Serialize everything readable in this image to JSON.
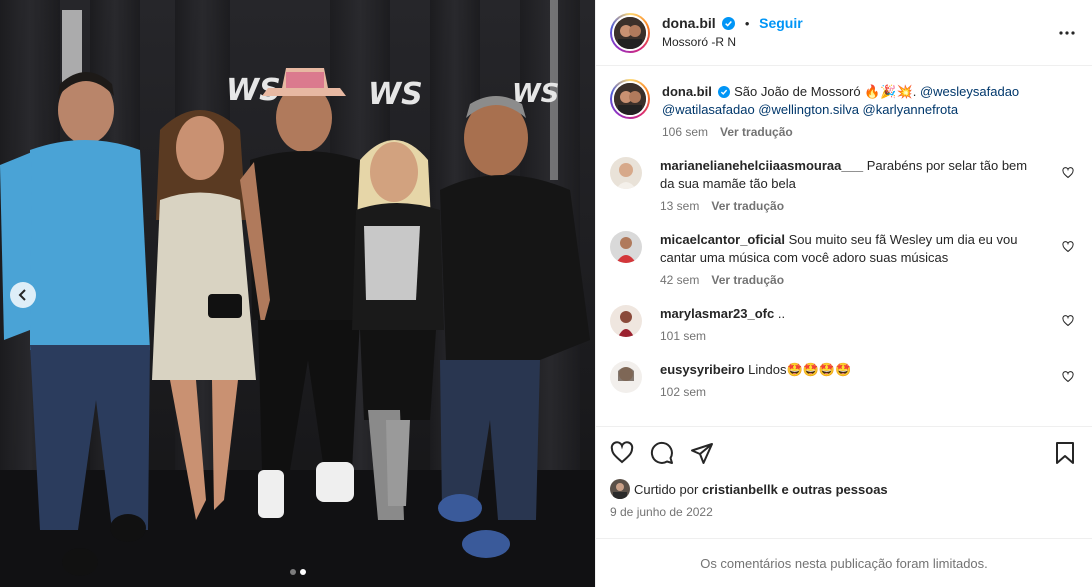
{
  "post": {
    "username": "dona.bil",
    "follow_label": "Seguir",
    "location": "Mossoró -R N",
    "separator": "•",
    "more_icon": "more-horizontal-icon"
  },
  "carousel": {
    "slides": 2,
    "current": 2
  },
  "caption": {
    "username": "dona.bil",
    "text": "São João de Mossoró 🔥🎉💥.",
    "mentions_line1": "@wesleysafadao",
    "mentions_line2": "@watilasafadao @wellington.silva @karlyannefrota",
    "time": "106 sem",
    "translate": "Ver tradução"
  },
  "comments": [
    {
      "username": "marianelianehelciiaasmouraa___",
      "text": "Parabéns por selar tão bem da sua mamãe tão bela",
      "time": "13 sem",
      "translate": "Ver tradução"
    },
    {
      "username": "micaelcantor_oficial",
      "text": "Sou muito seu fã Wesley um dia eu vou cantar uma música com você adoro suas músicas",
      "time": "42 sem",
      "translate": "Ver tradução"
    },
    {
      "username": "marylasmar23_ofc",
      "text": "..",
      "time": "101 sem"
    },
    {
      "username": "eusysyribeiro",
      "text": "Lindos🤩🤩🤩🤩",
      "time": "102 sem"
    }
  ],
  "likes": {
    "prefix": "Curtido por",
    "user": "cristianbellk",
    "suffix": "e outras pessoas"
  },
  "date": "9 de junho de 2022",
  "comments_limited": "Os comentários nesta publicação foram limitados.",
  "colors": {
    "accent": "#0095f6",
    "muted": "#737373",
    "mention": "#00376b"
  }
}
